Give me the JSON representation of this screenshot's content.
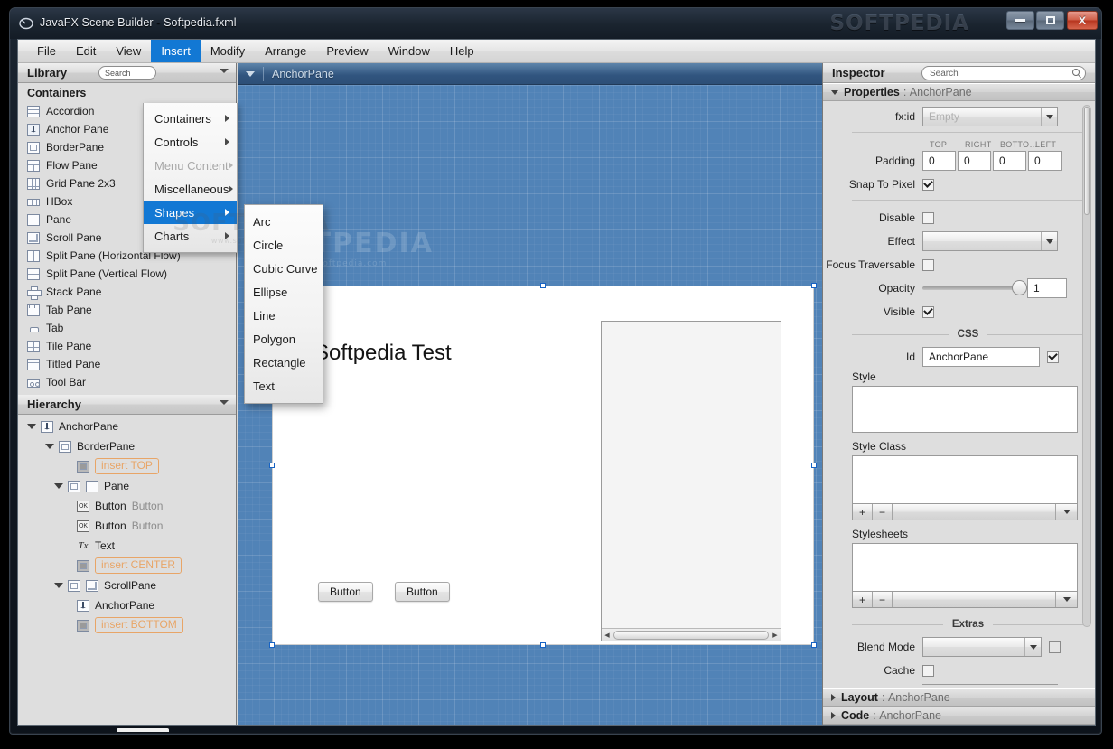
{
  "window": {
    "title": "JavaFX Scene Builder - Softpedia.fxml",
    "brand_watermark": "SOFTPEDIA",
    "minimize_label": "Minimize",
    "maximize_label": "Maximize",
    "close_label": "X"
  },
  "menubar": {
    "items": [
      {
        "label": "File",
        "active": false
      },
      {
        "label": "Edit",
        "active": false
      },
      {
        "label": "View",
        "active": false
      },
      {
        "label": "Insert",
        "active": true
      },
      {
        "label": "Modify",
        "active": false
      },
      {
        "label": "Arrange",
        "active": false
      },
      {
        "label": "Preview",
        "active": false
      },
      {
        "label": "Window",
        "active": false
      },
      {
        "label": "Help",
        "active": false
      }
    ]
  },
  "insert_menu": {
    "items": [
      {
        "label": "Containers",
        "state": "normal"
      },
      {
        "label": "Controls",
        "state": "normal"
      },
      {
        "label": "Menu Content",
        "state": "disabled"
      },
      {
        "label": "Miscellaneous",
        "state": "normal"
      },
      {
        "label": "Shapes",
        "state": "selected"
      },
      {
        "label": "Charts",
        "state": "normal"
      }
    ],
    "watermark": "SOFTPEDIA",
    "watermark_sub": "www.softpedia.com"
  },
  "shapes_submenu": {
    "items": [
      "Arc",
      "Circle",
      "Cubic Curve",
      "Ellipse",
      "Line",
      "Polygon",
      "Rectangle",
      "Text"
    ]
  },
  "library": {
    "title": "Library",
    "search_placeholder": "Search",
    "section": "Containers",
    "items": [
      {
        "label": "Accordion",
        "icon": "accordion-icon"
      },
      {
        "label": "Anchor Pane",
        "icon": "anchor-pane-icon"
      },
      {
        "label": "BorderPane",
        "icon": "border-pane-icon"
      },
      {
        "label": "Flow Pane",
        "icon": "flow-pane-icon"
      },
      {
        "label": "Grid Pane 2x3",
        "icon": "grid-pane-icon"
      },
      {
        "label": "HBox",
        "icon": "hbox-icon"
      },
      {
        "label": "Pane",
        "icon": "pane-icon"
      },
      {
        "label": "Scroll Pane",
        "icon": "scroll-pane-icon"
      },
      {
        "label": "Split Pane (Horizontal Flow)",
        "icon": "split-pane-horizontal-icon"
      },
      {
        "label": "Split Pane (Vertical Flow)",
        "icon": "split-pane-vertical-icon"
      },
      {
        "label": "Stack Pane",
        "icon": "stack-pane-icon"
      },
      {
        "label": "Tab Pane",
        "icon": "tab-pane-icon"
      },
      {
        "label": "Tab",
        "icon": "tab-icon"
      },
      {
        "label": "Tile Pane",
        "icon": "tile-pane-icon"
      },
      {
        "label": "Titled Pane",
        "icon": "titled-pane-icon"
      },
      {
        "label": "Tool Bar",
        "icon": "tool-bar-icon"
      }
    ]
  },
  "hierarchy": {
    "title": "Hierarchy",
    "nodes": [
      {
        "label": "AnchorPane",
        "sub": "",
        "indent": 0,
        "caret": "down",
        "icon": "anchor-pane-icon",
        "style": "normal"
      },
      {
        "label": "BorderPane",
        "sub": "",
        "indent": 1,
        "caret": "down",
        "icon": "border-pane-icon",
        "style": "normal"
      },
      {
        "label": "insert TOP",
        "sub": "",
        "indent": 2,
        "caret": "none",
        "icon": "border-pane-top-icon",
        "style": "placeholder"
      },
      {
        "label": "Pane",
        "sub": "",
        "indent": 2,
        "caret": "down",
        "icon": "pane-in-border-icon",
        "style": "normal"
      },
      {
        "label": "Button",
        "sub": "Button",
        "indent": 3,
        "caret": "none",
        "icon": "button-icon",
        "style": "normal"
      },
      {
        "label": "Button",
        "sub": "Button",
        "indent": 3,
        "caret": "none",
        "icon": "button-icon",
        "style": "normal"
      },
      {
        "label": "Text",
        "sub": "",
        "indent": 3,
        "caret": "none",
        "icon": "text-icon",
        "style": "normal"
      },
      {
        "label": "insert CENTER",
        "sub": "",
        "indent": 2,
        "caret": "none",
        "icon": "border-pane-center-icon",
        "style": "placeholder"
      },
      {
        "label": "ScrollPane",
        "sub": "",
        "indent": 2,
        "caret": "down",
        "icon": "scroll-pane-in-border-icon",
        "style": "normal"
      },
      {
        "label": "AnchorPane",
        "sub": "",
        "indent": 3,
        "caret": "none",
        "icon": "anchor-pane-icon",
        "style": "normal"
      },
      {
        "label": "insert BOTTOM",
        "sub": "",
        "indent": 2,
        "caret": "none",
        "icon": "border-pane-bottom-icon",
        "style": "placeholder"
      }
    ]
  },
  "breadcrumb": {
    "label": "AnchorPane"
  },
  "canvas": {
    "watermark": "SOFTPEDIA",
    "watermark_sub": "www.softpedia.com",
    "form_title": "Softpedia Test",
    "button_one": "Button",
    "button_two": "Button"
  },
  "inspector": {
    "title": "Inspector",
    "search_placeholder": "Search",
    "sections": {
      "properties": {
        "name": "Properties",
        "target": "AnchorPane",
        "expanded": true
      },
      "layout": {
        "name": "Layout",
        "target": "AnchorPane",
        "expanded": false
      },
      "code": {
        "name": "Code",
        "target": "AnchorPane",
        "expanded": false
      }
    },
    "properties": {
      "fxid_label": "fx:id",
      "fxid_value": "Empty",
      "padding_label": "Padding",
      "padding_headers": [
        "TOP",
        "RIGHT",
        "BOTTO…",
        "LEFT"
      ],
      "padding_values": [
        "0",
        "0",
        "0",
        "0"
      ],
      "snap_to_pixel_label": "Snap To Pixel",
      "snap_to_pixel_checked": true,
      "disable_label": "Disable",
      "disable_checked": false,
      "effect_label": "Effect",
      "effect_value": "",
      "focus_traversable_label": "Focus Traversable",
      "focus_traversable_checked": false,
      "opacity_label": "Opacity",
      "opacity_value": "1",
      "visible_label": "Visible",
      "visible_checked": true,
      "css_section": "CSS",
      "id_label": "Id",
      "id_value": "AnchorPane",
      "id_checked": true,
      "style_label": "Style",
      "style_value": "",
      "style_class_label": "Style Class",
      "style_class_value": "",
      "stylesheets_label": "Stylesheets",
      "stylesheets_value": "",
      "add_button": "+",
      "remove_button": "−",
      "extras_section": "Extras",
      "blend_mode_label": "Blend Mode",
      "blend_mode_value": "",
      "blend_mode_checked": false,
      "cache_label": "Cache",
      "cache_checked": false
    }
  }
}
